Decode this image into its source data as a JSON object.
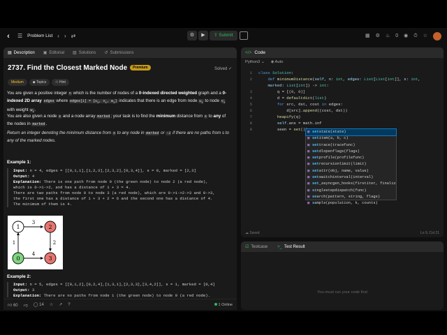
{
  "topbar": {
    "problem_list": "Problem List",
    "submit": "Submit",
    "fire_count": "0",
    "logo_icon": "leetcode-logo-icon"
  },
  "tabs": [
    {
      "label": "Description",
      "icon": "document-icon"
    },
    {
      "label": "Editorial",
      "icon": "book-icon"
    },
    {
      "label": "Solutions",
      "icon": "flask-icon"
    },
    {
      "label": "Submissions",
      "icon": "history-icon"
    }
  ],
  "problem": {
    "title": "2737. Find the Closest Marked Node",
    "premium": "Premium",
    "status": "Solved",
    "chips": [
      "Medium",
      "Topics",
      "Hint"
    ]
  },
  "description": {
    "p1_a": "You are given a positive integer",
    "p1_n": "n",
    "p1_b": "which is the number of nodes of a",
    "p1_bold": "0-indexed directed weighted",
    "p1_c": "graph and a",
    "p1_bold2": "0-indexed 2D array",
    "p1_edges": "edges",
    "p1_d": "where",
    "p1_code": "edges[i] = [u",
    "p1_code_sub1": "i",
    "p1_code_mid1": ", v",
    "p1_code_sub2": "i",
    "p1_code_mid2": ", w",
    "p1_code_sub3": "i",
    "p1_code_end": "]",
    "p1_e": "indicates that there is an edge from node",
    "p1_u": "u",
    "p1_u_sub": "i",
    "p1_f": "to node",
    "p1_v": "v",
    "p1_v_sub": "i",
    "p1_g": "with weight",
    "p1_w": "w",
    "p1_w_sub": "i",
    "p1_h": ".",
    "p2_a": "You are also given a node",
    "p2_s": "s",
    "p2_b": "and a node array",
    "p2_marked": "marked",
    "p2_c": "; your task is to find the",
    "p2_bold": "minimum",
    "p2_d": "distance from",
    "p2_s2": "s",
    "p2_e": "to",
    "p2_bold2": "any",
    "p2_f": "of the nodes in",
    "p2_marked2": "marked",
    "p2_g": ".",
    "p3_a": "Return an integer denoting the minimum distance from",
    "p3_s": "s",
    "p3_b": "to any node in",
    "p3_marked": "marked",
    "p3_c": "or",
    "p3_neg": "-1",
    "p3_d": "if there are no paths from s to any of the marked nodes."
  },
  "example1": {
    "heading": "Example 1:",
    "lines": [
      {
        "label": "Input:",
        "text": " n = 4, edges = [[0,1,1],[1,2,3],[2,3,2],[0,3,4]], s = 0, marked = [2,3]"
      },
      {
        "label": "Output:",
        "text": " 4"
      },
      {
        "label": "Explanation:",
        "text": " There is one path from node 0 (the green node) to node 2 (a red node),"
      },
      {
        "label": "",
        "text": "which is 0->1->2, and has a distance of 1 + 3 = 4."
      },
      {
        "label": "",
        "text": "There are two paths from node 0 to node 3 (a red node), which are 0->1->2->3 and 0->3,"
      },
      {
        "label": "",
        "text": "the first one has a distance of 1 + 3 + 2 = 6 and the second one has a distance of 4."
      },
      {
        "label": "",
        "text": "The minimum of them is 4."
      }
    ]
  },
  "graph": {
    "nodes": [
      "1",
      "2",
      "0",
      "3"
    ],
    "edges": [
      "3",
      "1",
      "2",
      "4"
    ]
  },
  "example2": {
    "heading": "Example 2:",
    "lines": [
      {
        "label": "Input:",
        "text": " n = 5, edges = [[0,1,2],[0,2,4],[1,3,1],[2,3,3],[3,4,2]], s = 1, marked = [0,4]"
      },
      {
        "label": "Output:",
        "text": " 3"
      },
      {
        "label": "Explanation:",
        "text": " There are no paths from node 1 (the green node) to node 0 (a red node)."
      }
    ]
  },
  "footer": {
    "likes": "60",
    "comments": "14",
    "online": "1 Online"
  },
  "code": {
    "title": "Code",
    "language": "Python3",
    "auto": "Auto",
    "saved": "Saved",
    "position": "Ln 9, Col 21",
    "line_numbers": [
      "1",
      "2",
      "3",
      "4",
      "5",
      "6",
      "7",
      "8",
      "9"
    ]
  },
  "autocomplete": [
    {
      "pre": "set",
      "rest": "state(state)"
    },
    {
      "pre": "set",
      "rest": "item(a, b, c)"
    },
    {
      "pre": "set",
      "rest": "trace(tracefunc)"
    },
    {
      "pre": "set",
      "rest": "dlopenflags(flags)"
    },
    {
      "pre": "set",
      "rest": "profile(profilefunc)"
    },
    {
      "pre": "set",
      "rest": "recursionlimit(limit)"
    },
    {
      "pre": "set",
      "rest": "attr(obj, name, value)"
    },
    {
      "pre": "set",
      "rest": "switchinterval(interval)"
    },
    {
      "pre": "set",
      "rest": "_asyncgen_hooks(firstiter, finalizer)"
    },
    {
      "pre": "s",
      "rest": "inglestepdispatch(func)"
    },
    {
      "pre": "se",
      "rest": "arch(pattern, string, flags)"
    },
    {
      "pre": "s",
      "rest": "ample(population, k, counts)"
    }
  ],
  "test": {
    "tab1": "Testcase",
    "tab2": "Test Result",
    "message": "You must run your code first"
  }
}
